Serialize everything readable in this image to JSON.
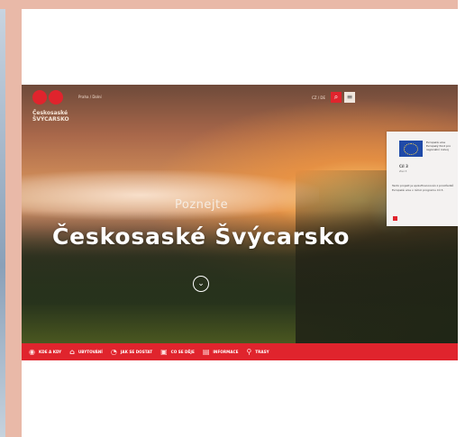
{
  "header": {
    "logo_line1": "Českosaské",
    "logo_line2": "ŠVÝCARSKO",
    "top_link": "Praha / Dolní",
    "language": "CZ / DE",
    "search_icon": "magnifier",
    "menu_icon": "hamburger"
  },
  "hero": {
    "subtitle": "Poznejte",
    "title": "Českosaské Švýcarsko",
    "scroll_icon": "chevron-down"
  },
  "eu_banner": {
    "heading": "Evropská unie Evropský fond pro regionální rozvoj",
    "program": "Cíl 3",
    "caption": "Ziel 3",
    "text": "Tento projekt je spolufinancován z prostředků Evropské unie v rámci programu Cíl 3."
  },
  "bottom_nav": [
    {
      "label": "KDE A KDY",
      "icon": "map-pin-icon"
    },
    {
      "label": "UBYTOVÁNÍ",
      "icon": "bed-icon"
    },
    {
      "label": "JAK SE DOSTAT",
      "icon": "car-icon"
    },
    {
      "label": "CO SE DĚJE",
      "icon": "calendar-icon"
    },
    {
      "label": "INFORMACE",
      "icon": "info-icon"
    },
    {
      "label": "TRASY",
      "icon": "hiker-icon"
    }
  ],
  "colors": {
    "brand_red": "#e0242d",
    "frame": "#e9b9a8"
  }
}
